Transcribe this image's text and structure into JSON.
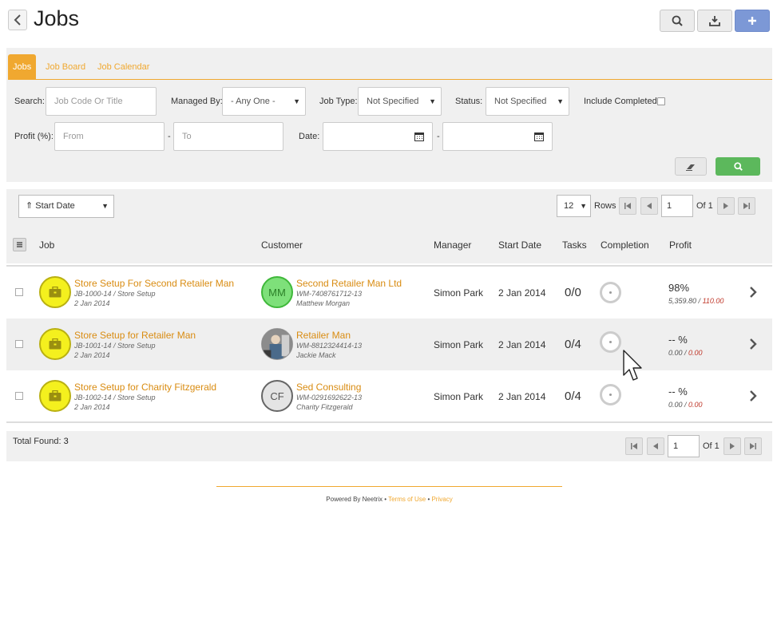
{
  "header": {
    "title": "Jobs",
    "icons": [
      "back-icon",
      "search-icon",
      "download-icon",
      "plus-icon"
    ]
  },
  "tabs": [
    {
      "label": "Jobs",
      "active": true
    },
    {
      "label": "Job Board",
      "active": false
    },
    {
      "label": "Job Calendar",
      "active": false
    }
  ],
  "filters": {
    "search_label": "Search:",
    "search_placeholder": "Job Code Or Title",
    "managed_by_label": "Managed By:",
    "managed_by_value": "- Any One -",
    "job_type_label": "Job Type:",
    "job_type_value": "Not Specified",
    "status_label": "Status:",
    "status_value": "Not Specified",
    "include_completed_label": "Include Completed:",
    "profit_label": "Profit (%):",
    "profit_from_placeholder": "From",
    "profit_to_placeholder": "To",
    "range_sep": "-",
    "date_label": "Date:"
  },
  "list": {
    "sort_value": "⇑ Start Date",
    "rows_value": "12",
    "rows_label": "Rows",
    "page_value": "1",
    "of_label": "Of 1"
  },
  "columns": {
    "job": "Job",
    "customer": "Customer",
    "manager": "Manager",
    "start_date": "Start Date",
    "tasks": "Tasks",
    "completion": "Completion",
    "profit": "Profit"
  },
  "rows": [
    {
      "title": "Store Setup For Second Retailer Man",
      "code": "JB-1000-14 / Store Setup",
      "date": "2 Jan 2014",
      "customer_initials": "MM",
      "customer": "Second Retailer Man Ltd",
      "customer_code": "WM-7408761712-13",
      "contact": "Matthew Morgan",
      "manager": "Simon Park",
      "start_date": "2 Jan 2014",
      "tasks": "0/0",
      "completion": 0,
      "profit": "98%",
      "profit_actual": "5,359.80",
      "profit_sep": " / ",
      "profit_target": "110.00"
    },
    {
      "title": "Store Setup for Retailer Man",
      "code": "JB-1001-14 / Store Setup",
      "date": "2 Jan 2014",
      "customer_initials": "",
      "customer": "Retailer Man",
      "customer_code": "WM-8812324414-13",
      "contact": "Jackie Mack",
      "manager": "Simon Park",
      "start_date": "2 Jan 2014",
      "tasks": "0/4",
      "completion": 0,
      "profit": "-- %",
      "profit_actual": "0.00",
      "profit_sep": " / ",
      "profit_target": "0.00"
    },
    {
      "title": "Store Setup for Charity Fitzgerald",
      "code": "JB-1002-14 / Store Setup",
      "date": "2 Jan 2014",
      "customer_initials": "CF",
      "customer": "Sed Consulting",
      "customer_code": "WM-0291692622-13",
      "contact": "Charity Fitzgerald",
      "manager": "Simon Park",
      "start_date": "2 Jan 2014",
      "tasks": "0/4",
      "completion": 0,
      "profit": "-- %",
      "profit_actual": "0.00",
      "profit_sep": " / ",
      "profit_target": "0.00"
    }
  ],
  "footer": {
    "total_label": "Total Found:",
    "total_value": "3",
    "page_value": "1",
    "of_label": "Of 1"
  },
  "powered": {
    "text": "Powered By Neetrix",
    "sep": " • ",
    "terms": "Terms of Use",
    "privacy": "Privacy"
  },
  "colors": {
    "accent": "#f0a830",
    "primary_button": "#7c98d6",
    "search_button": "#5cb85c",
    "job_icon": "#f4f01e"
  }
}
